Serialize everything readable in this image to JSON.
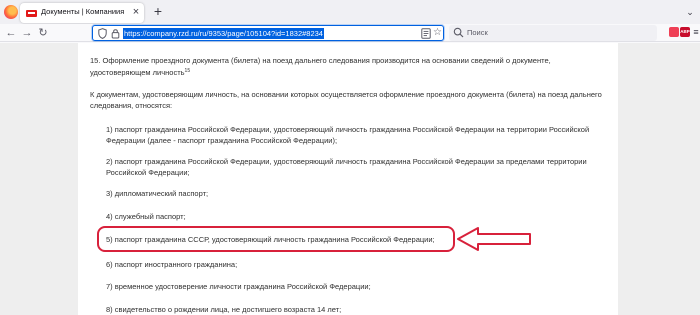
{
  "browser": {
    "tab": {
      "title": "Документы | Компаниия"
    },
    "url": "https://company.rzd.ru/ru/9353/page/105104?id=1832#8234",
    "search_placeholder": "Поиск",
    "extensions": {
      "abp_label": "ABP"
    }
  },
  "document": {
    "intro": {
      "text": "15. Оформление проездного документа (билета) на поезд дальнего следования производится на основании сведений о документе, удостоверяющем личность",
      "footnote": "15"
    },
    "lead": "К документам, удостоверяющим личность, на основании которых осуществляется оформление проездного документа (билета) на поезд дальнего следования, относятся:",
    "items": [
      "1) паспорт гражданина Российской Федерации, удостоверяющий личность гражданина Российской Федерации на территории Российской Федерации (далее - паспорт гражданина Российской Федерации);",
      "2) паспорт гражданина Российской Федерации, удостоверяющий личность гражданина Российской Федерации за пределами территории Российской Федерации;",
      "3) дипломатический паспорт;",
      "4) служебный паспорт;",
      "5) паспорт гражданина СССР, удостоверяющий личность гражданина Российской Федерации;",
      "6) паспорт иностранного гражданина;",
      "7) временное удостоверение личности гражданина Российской Федерации;",
      "8) свидетельство о рождении лица, не достигшего возраста 14 лет;"
    ]
  },
  "annotation": {
    "color": "#d8213b",
    "highlighted_item": 4
  }
}
